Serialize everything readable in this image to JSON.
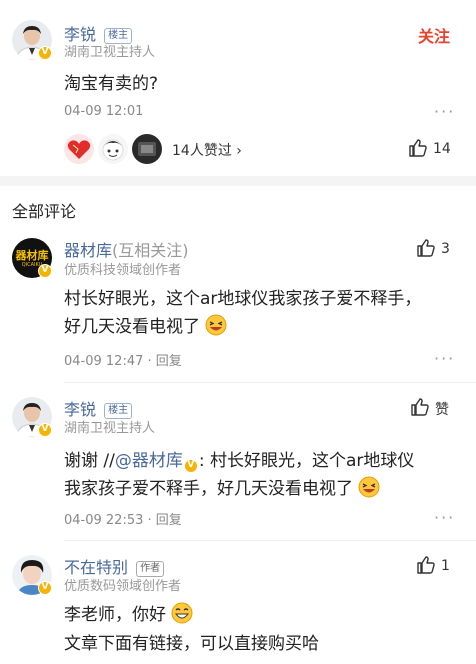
{
  "post": {
    "author": "李锐",
    "author_tag": "楼主",
    "author_subtitle": "湖南卫视主持人",
    "follow_label": "关注",
    "content": "淘宝有卖的?",
    "time": "04-09 12:01",
    "more": "···",
    "likers_text": "14人赞过 ›",
    "like_count": "14",
    "accent_color": "#e8432e"
  },
  "section_title": "全部评论",
  "comments": [
    {
      "author": "器材库",
      "relation": "(互相关注)",
      "subtitle": "优质科技领域创作者",
      "like_count": "3",
      "line1": "村长好眼光，这个ar地球仪我家孩子爱不释手，",
      "line2": "好几天没看电视了",
      "time": "04-09 12:47",
      "reply": "· 回复",
      "more": "···",
      "avatar_text": "器材库",
      "avatar_subtext": "QICAIKU"
    },
    {
      "author": "李锐",
      "tag": "楼主",
      "subtitle": "湖南卫视主持人",
      "like_label": "赞",
      "line1_prefix": "谢谢 //",
      "mention": "@器材库",
      "line1_suffix": ": 村长好眼光，这个ar地球仪",
      "line2": "我家孩子爱不释手，好几天没看电视了",
      "time": "04-09 22:53",
      "reply": "· 回复",
      "more": "···"
    },
    {
      "author": "不在特别",
      "tag": "作者",
      "subtitle": "优质数码领域创作者",
      "like_count": "1",
      "line1": "李老师，你好",
      "line2": "文章下面有链接，可以直接购买哈"
    }
  ],
  "icons": {
    "thumb": "thumbs-up-icon",
    "verified": "verified-v-icon",
    "more": "more-dots-icon"
  }
}
